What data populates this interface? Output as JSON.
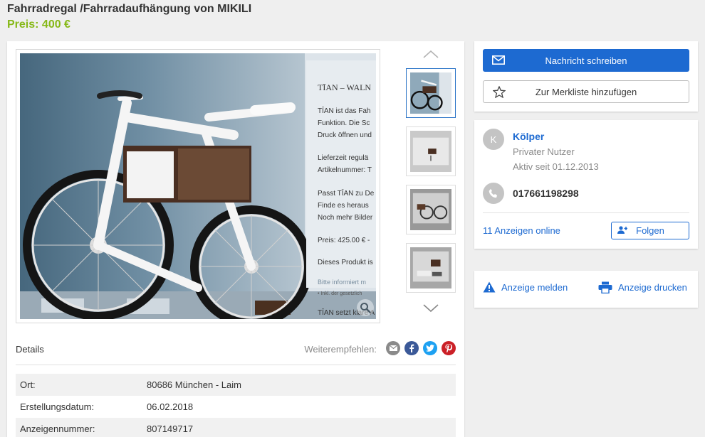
{
  "listing": {
    "title": "Fahrradregal /Fahrradaufhängung von MIKILI",
    "price": "Preis: 400 €"
  },
  "gallery": {
    "photo_text": {
      "heading": "TĪAN – WALN",
      "lines": [
        "TĪAN ist das Fah",
        "Funktion. Die Sc",
        "Druck öffnen und",
        "",
        "Lieferzeit regulä",
        "Artikelnummer: T",
        "",
        "Passt TĪAN zu De",
        "Finde es heraus",
        "Noch mehr Bilder",
        "",
        "Preis: 425.00 € -",
        "",
        "Dieses Produkt is"
      ],
      "footer_1": "Bitte informiert m",
      "footer_2": "• Inkl. der gesetzlich",
      "footer_3": "TĪAN setzt klare A"
    },
    "thumbnails": [
      "thumb-1",
      "thumb-2",
      "thumb-3",
      "thumb-4"
    ]
  },
  "details": {
    "label": "Details",
    "share_label": "Weiterempfehlen:",
    "attributes": [
      {
        "label": "Ort:",
        "value": "80686 München - Laim"
      },
      {
        "label": "Erstellungsdatum:",
        "value": "06.02.2018"
      },
      {
        "label": "Anzeigennummer:",
        "value": "807149717"
      }
    ]
  },
  "actions": {
    "message_button": "Nachricht schreiben",
    "watchlist_button": "Zur Merkliste hinzufügen"
  },
  "seller": {
    "avatar_letter": "K",
    "name": "Kölper",
    "type": "Privater Nutzer",
    "active_since": "Aktiv seit 01.12.2013",
    "phone": "017661198298",
    "ads_online": "11 Anzeigen online",
    "follow_button": "Folgen"
  },
  "report": {
    "report_label": "Anzeige melden",
    "print_label": "Anzeige drucken"
  },
  "colors": {
    "primary": "#1d6ad1",
    "price": "#86b817",
    "share_mail": "#8a8a8a",
    "share_facebook": "#3b5998",
    "share_twitter": "#1da1f2",
    "share_pinterest": "#cb2027"
  },
  "icons": {
    "message": "envelope-icon",
    "watchlist": "star-icon",
    "phone": "phone-icon",
    "follow": "user-plus-icon",
    "report": "warning-icon",
    "print": "printer-icon",
    "zoom": "magnifier-icon"
  }
}
